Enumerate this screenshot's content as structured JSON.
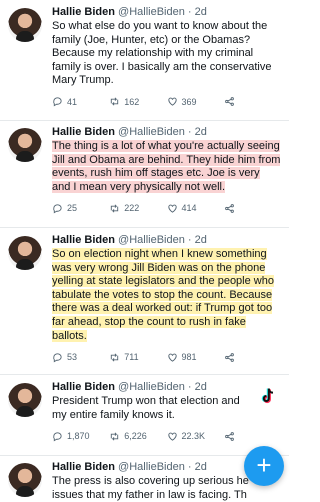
{
  "tweets": [
    {
      "name": "Hallie Biden",
      "handle": "@HallieBiden",
      "time": "· 2d",
      "text": "So what else do you want to know about the family (Joe, Hunter, etc) or the Obamas? Because my relationship with my criminal family is over. I basically am the conservative Mary Trump.",
      "replies": "41",
      "retweets": "162",
      "likes": "369"
    },
    {
      "name": "Hallie Biden",
      "handle": "@HallieBiden",
      "time": "· 2d",
      "text": "The thing is a lot of what you're actually seeing Jill and Obama are behind. They hide him from events, rush him off stages etc. Joe is very and I mean very physically not well.",
      "replies": "25",
      "retweets": "222",
      "likes": "414"
    },
    {
      "name": "Hallie Biden",
      "handle": "@HallieBiden",
      "time": "· 2d",
      "text": "So on election night when I knew something was very wrong Jill Biden was on the phone yelling at state legislators and the people who tabulate the votes to stop the count. Because there was a deal worked out: if Trump got too far ahead, stop the count to rush in fake ballots.",
      "replies": "53",
      "retweets": "711",
      "likes": "981"
    },
    {
      "name": "Hallie Biden",
      "handle": "@HallieBiden",
      "time": "· 2d",
      "text": "President Trump won that election and my entire family knows it.",
      "replies": "1,870",
      "retweets": "6,226",
      "likes": "22.3K"
    },
    {
      "name": "Hallie Biden",
      "handle": "@HallieBiden",
      "time": "· 2d",
      "text": "The press is also covering up serious he issues that my father in law is facing. Th"
    }
  ],
  "fab_label": "+",
  "icons": [
    "reply-icon",
    "retweet-icon",
    "like-icon",
    "share-icon",
    "tiktok-icon",
    "compose-icon"
  ],
  "colors": {
    "accent": "#1d9bf0",
    "text": "#0f1419",
    "muted": "#536471",
    "highlight_pink": "#f8c8c8",
    "highlight_yellow": "#ffee96"
  }
}
